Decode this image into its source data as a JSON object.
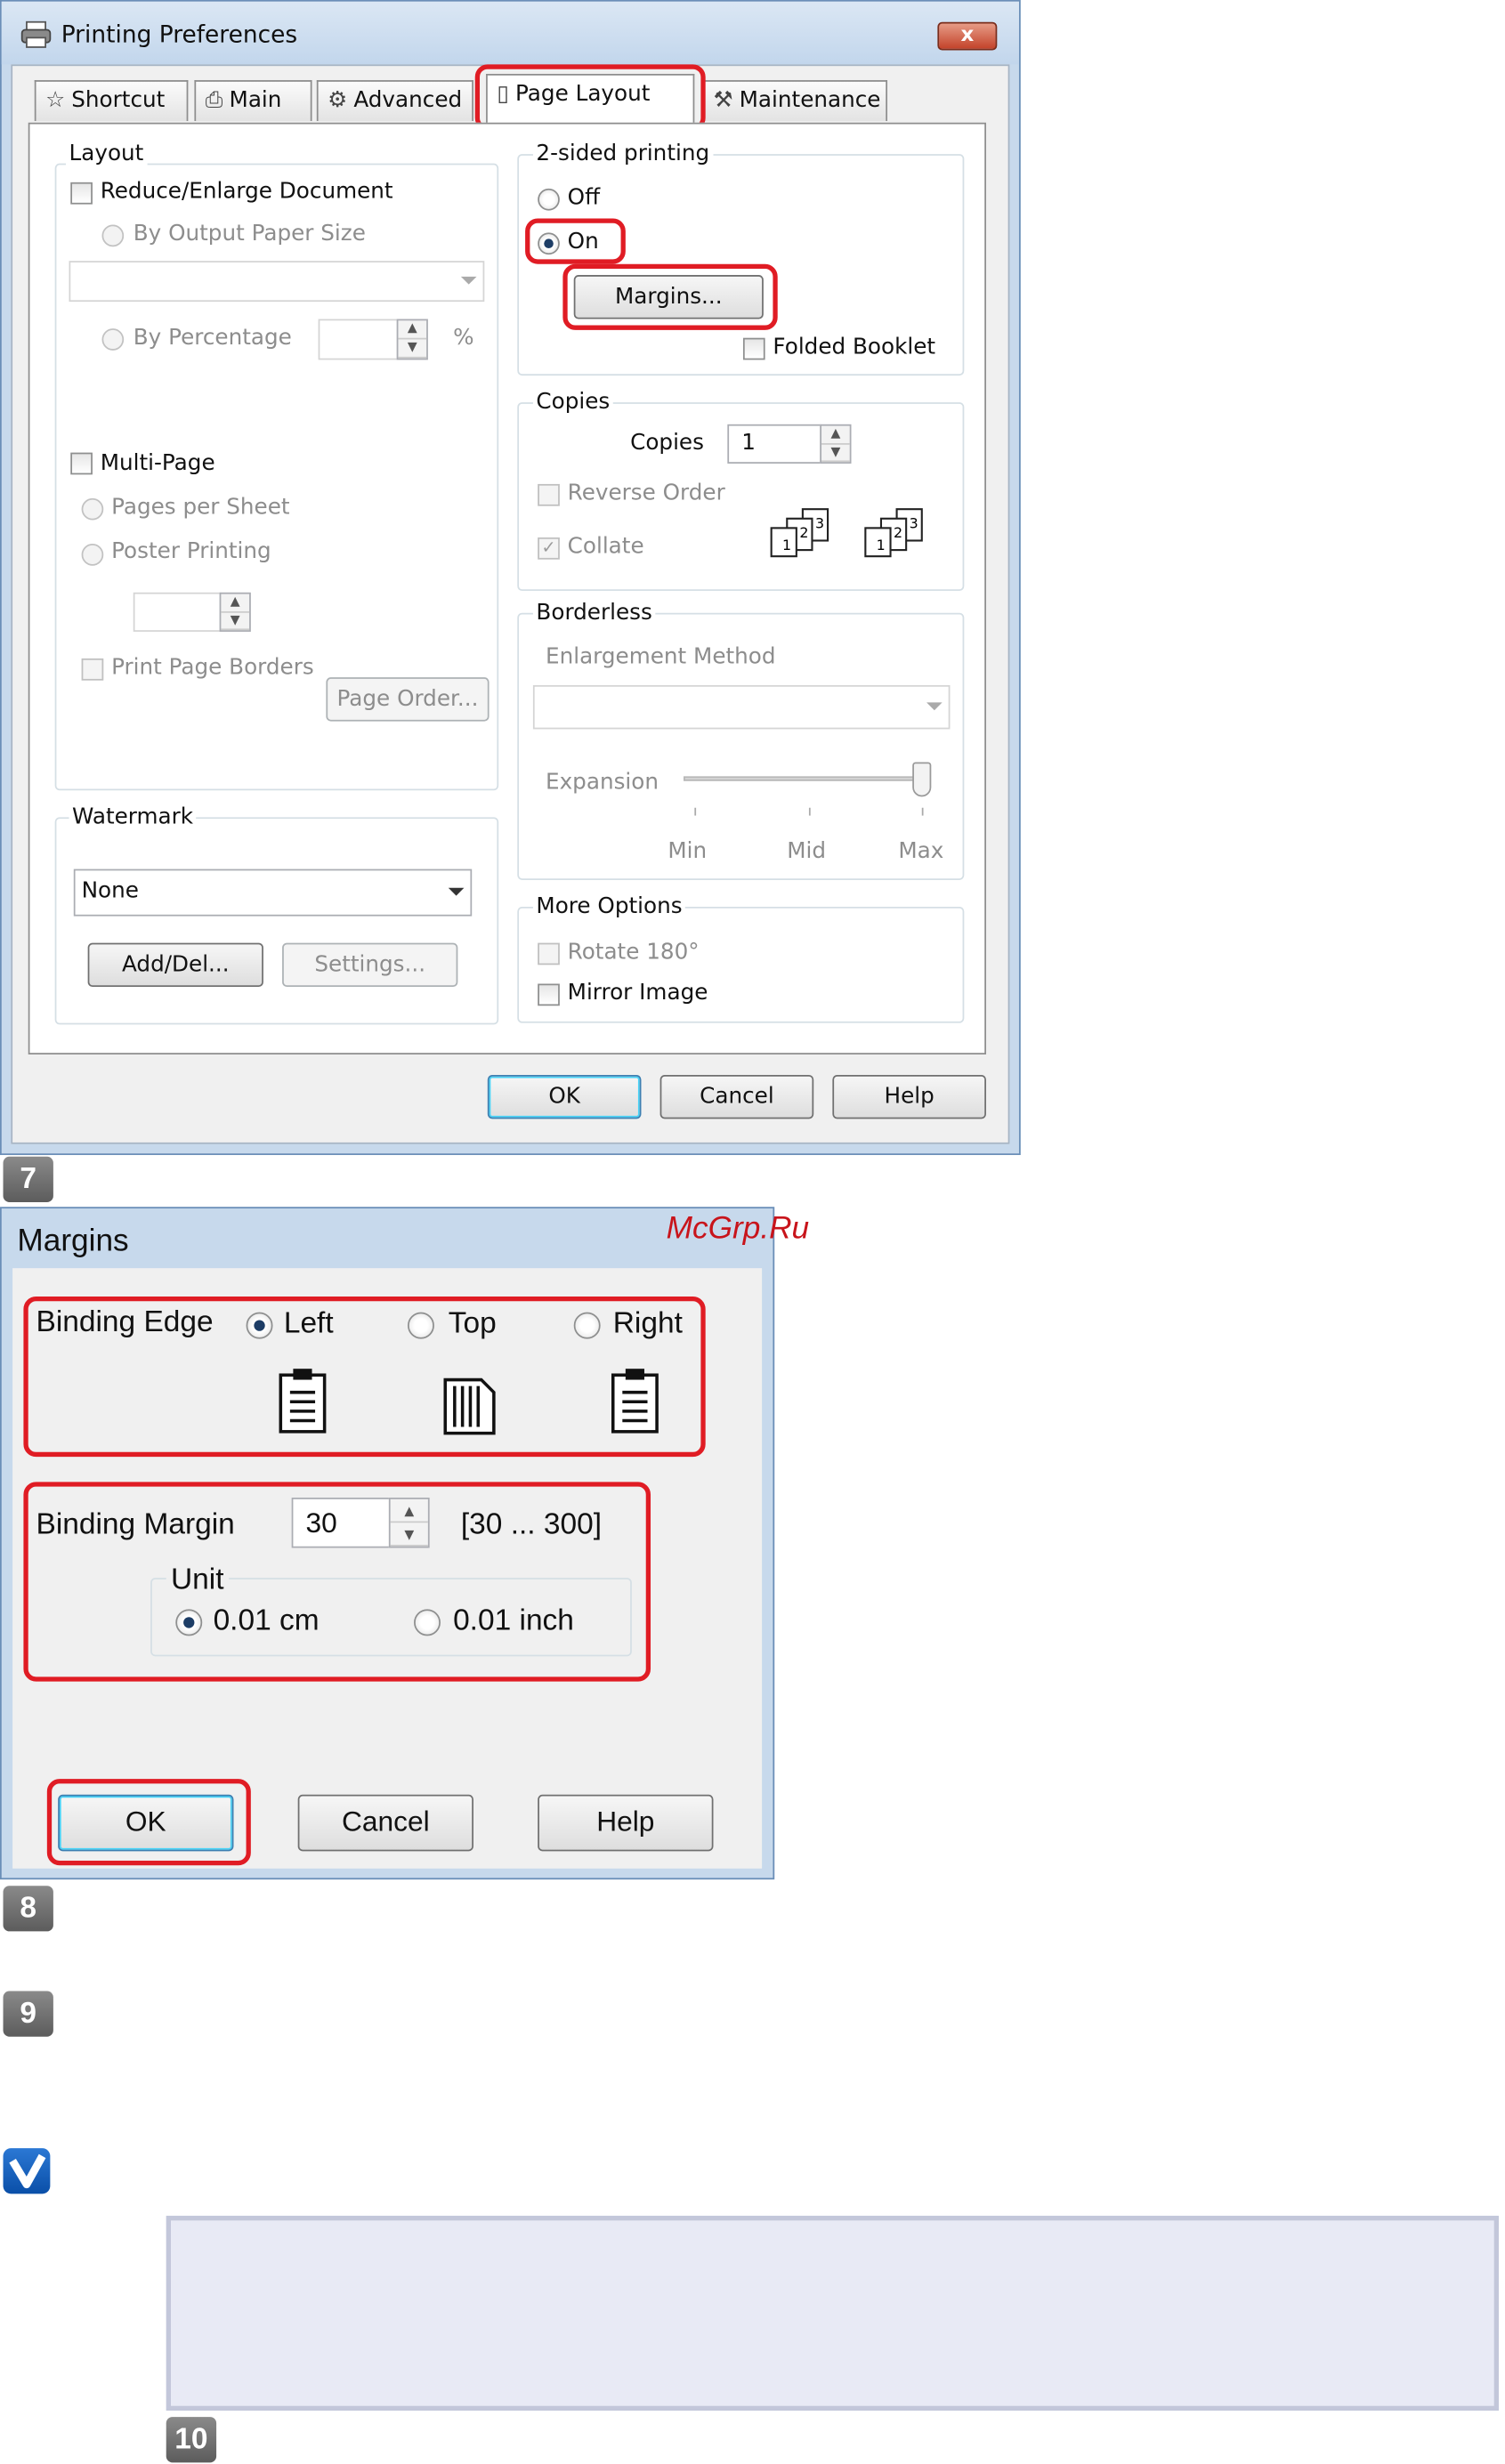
{
  "dialog1": {
    "title": "Printing Preferences",
    "close": "x",
    "tabs": [
      "Shortcut",
      "Main",
      "Advanced",
      "Page Layout",
      "Maintenance"
    ],
    "layout": {
      "group": "Layout",
      "reduce": "Reduce/Enlarge Document",
      "by_output": "By Output Paper Size",
      "by_percentage": "By Percentage",
      "percent_sign": "%",
      "multipage": "Multi-Page",
      "pages_per_sheet": "Pages per Sheet",
      "poster": "Poster Printing",
      "page_borders": "Print Page Borders",
      "page_order": "Page Order..."
    },
    "watermark": {
      "group": "Watermark",
      "value": "None",
      "add_del": "Add/Del...",
      "settings": "Settings..."
    },
    "two_sided": {
      "group": "2-sided printing",
      "off": "Off",
      "on": "On",
      "margins": "Margins...",
      "folded": "Folded Booklet"
    },
    "copies": {
      "group": "Copies",
      "label": "Copies",
      "value": "1",
      "reverse": "Reverse Order",
      "collate": "Collate"
    },
    "borderless": {
      "group": "Borderless",
      "method": "Enlargement Method",
      "expansion": "Expansion",
      "min": "Min",
      "mid": "Mid",
      "max": "Max",
      "slider_level": 1.0
    },
    "more": {
      "group": "More Options",
      "rotate": "Rotate 180°",
      "mirror": "Mirror Image"
    },
    "buttons": {
      "ok": "OK",
      "cancel": "Cancel",
      "help": "Help"
    }
  },
  "steps": [
    "7",
    "8",
    "9",
    "10"
  ],
  "watermark_text": "McGrp.Ru",
  "dialog2": {
    "title": "Margins",
    "binding_edge": "Binding Edge",
    "left": "Left",
    "top": "Top",
    "right": "Right",
    "binding_margin": "Binding Margin",
    "margin_value": "30",
    "range": "[30 ... 300]",
    "unit": "Unit",
    "cm": "0.01 cm",
    "inch": "0.01 inch",
    "ok": "OK",
    "cancel": "Cancel",
    "help": "Help"
  }
}
